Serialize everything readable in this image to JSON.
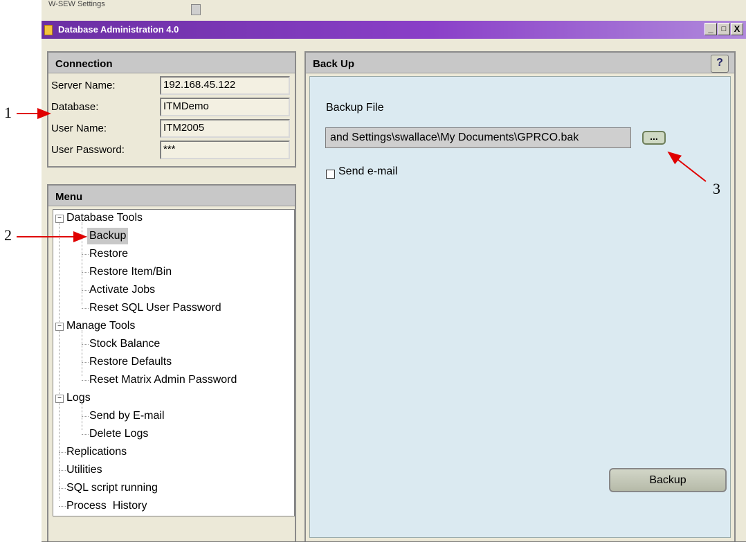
{
  "topstrip": {
    "title": "W-SEW Settings"
  },
  "window": {
    "title": "Database Administration 4.0",
    "min": "_",
    "max": "□",
    "close": "X"
  },
  "connection": {
    "heading": "Connection",
    "rows": [
      {
        "label": "Server Name:",
        "value": "192.168.45.122"
      },
      {
        "label": "Database:",
        "value": "ITMDemo"
      },
      {
        "label": "User Name:",
        "value": "ITM2005"
      },
      {
        "label": "User Password:",
        "value": "***"
      }
    ]
  },
  "menu": {
    "heading": "Menu",
    "items": [
      {
        "label": "Database Tools",
        "expander": "−"
      },
      {
        "label": "Backup"
      },
      {
        "label": "Restore"
      },
      {
        "label": "Restore Item/Bin"
      },
      {
        "label": "Activate Jobs"
      },
      {
        "label": "Reset SQL User Password"
      },
      {
        "label": "Manage Tools",
        "expander": "−"
      },
      {
        "label": "Stock Balance"
      },
      {
        "label": "Restore Defaults"
      },
      {
        "label": "Reset Matrix Admin Password"
      },
      {
        "label": "Logs",
        "expander": "−"
      },
      {
        "label": "Send by E-mail"
      },
      {
        "label": "Delete Logs"
      },
      {
        "label": "Replications"
      },
      {
        "label": "Utilities"
      },
      {
        "label": "SQL script running"
      },
      {
        "label": "Process  History"
      }
    ]
  },
  "backup": {
    "heading": "Back Up",
    "help": "?",
    "file_label": "Backup File",
    "file_value": "and Settings\\swallace\\My Documents\\GPRCO.bak",
    "browse": "...",
    "send_email": "Send e-mail",
    "send_email_checked": false,
    "button": "Backup"
  },
  "annotations": [
    "1",
    "2",
    "3"
  ],
  "colors": {
    "titlebar": "#7a35b8",
    "arrow": "#e00000",
    "panel_bg": "#dbeaf1"
  }
}
